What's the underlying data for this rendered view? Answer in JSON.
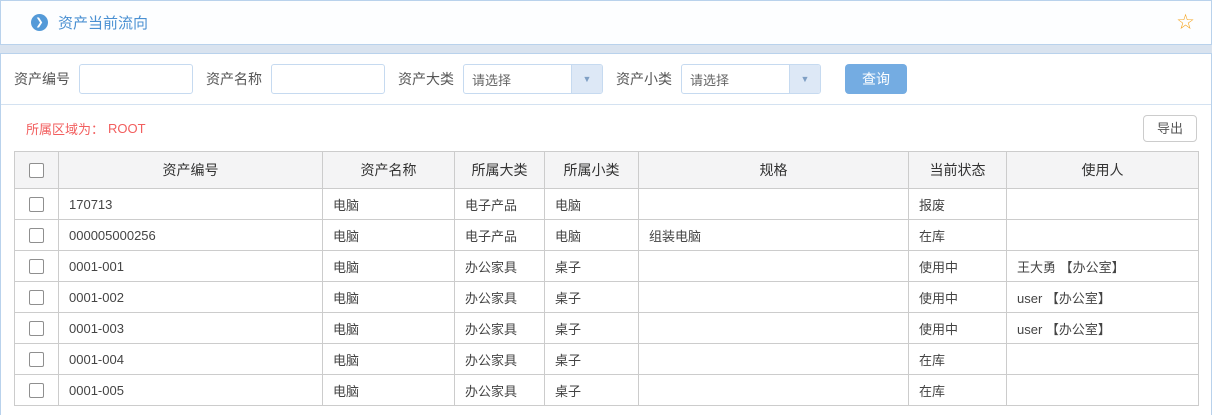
{
  "colors": {
    "panel_border": "#b9d2ec",
    "page_background": "#d9e3ef",
    "title_blue": "#4a90d2",
    "icon_circle_blue": "#549ad8",
    "star_orange": "#f5a623",
    "search_button_blue": "#74ace2",
    "region_text_red": "#f25e5e",
    "table_border_gray": "#cccccc",
    "table_header_bg": "#f4f4f5"
  },
  "header": {
    "title": "资产当前流向",
    "arrow_icon": "❯",
    "star_icon": "☆"
  },
  "filters": {
    "asset_code_label": "资产编号",
    "asset_code_value": "",
    "asset_name_label": "资产名称",
    "asset_name_value": "",
    "category_label": "资产大类",
    "category_selected": "请选择",
    "subcategory_label": "资产小类",
    "subcategory_selected": "请选择",
    "dropdown_arrow": "▼",
    "search_button": "查询"
  },
  "region": {
    "label": "所属区域为：",
    "value": "ROOT",
    "export_button": "导出"
  },
  "table": {
    "columns": [
      "资产编号",
      "资产名称",
      "所属大类",
      "所属小类",
      "规格",
      "当前状态",
      "使用人"
    ],
    "rows": [
      [
        "170713",
        "电脑",
        "电子产品",
        "电脑",
        "",
        "报废",
        ""
      ],
      [
        "000005000256",
        "电脑",
        "电子产品",
        "电脑",
        "组装电脑",
        "在库",
        ""
      ],
      [
        "0001-001",
        "电脑",
        "办公家具",
        "桌子",
        "",
        "使用中",
        "王大勇 【办公室】"
      ],
      [
        "0001-002",
        "电脑",
        "办公家具",
        "桌子",
        "",
        "使用中",
        "user 【办公室】"
      ],
      [
        "0001-003",
        "电脑",
        "办公家具",
        "桌子",
        "",
        "使用中",
        "user 【办公室】"
      ],
      [
        "0001-004",
        "电脑",
        "办公家具",
        "桌子",
        "",
        "在库",
        ""
      ],
      [
        "0001-005",
        "电脑",
        "办公家具",
        "桌子",
        "",
        "在库",
        ""
      ]
    ]
  }
}
